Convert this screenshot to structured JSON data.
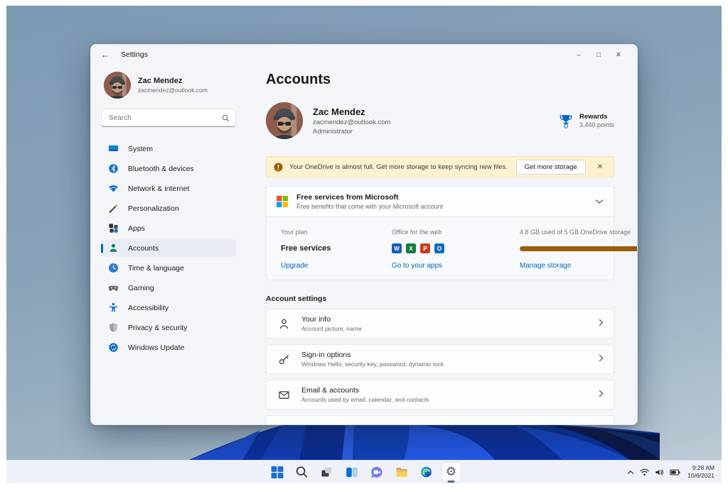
{
  "window": {
    "title": "Settings",
    "controls": {
      "minimize": "–",
      "maximize": "□",
      "close": "✕"
    }
  },
  "sidebar": {
    "profile": {
      "name": "Zac Mendez",
      "email": "zacmendez@outlook.com"
    },
    "search": {
      "placeholder": "Search"
    },
    "items": [
      {
        "label": "System",
        "icon": "system-icon",
        "selected": false
      },
      {
        "label": "Bluetooth & devices",
        "icon": "bluetooth-icon",
        "selected": false
      },
      {
        "label": "Network & internet",
        "icon": "network-icon",
        "selected": false
      },
      {
        "label": "Personalization",
        "icon": "personalization-icon",
        "selected": false
      },
      {
        "label": "Apps",
        "icon": "apps-icon",
        "selected": false
      },
      {
        "label": "Accounts",
        "icon": "accounts-icon",
        "selected": true
      },
      {
        "label": "Time & language",
        "icon": "time-language-icon",
        "selected": false
      },
      {
        "label": "Gaming",
        "icon": "gaming-icon",
        "selected": false
      },
      {
        "label": "Accessibility",
        "icon": "accessibility-icon",
        "selected": false
      },
      {
        "label": "Privacy & security",
        "icon": "privacy-icon",
        "selected": false
      },
      {
        "label": "Windows Update",
        "icon": "windows-update-icon",
        "selected": false
      }
    ]
  },
  "main": {
    "page_title": "Accounts",
    "profile": {
      "name": "Zac Mendez",
      "email": "zacmendez@outlook.com",
      "role": "Administrator"
    },
    "rewards": {
      "label": "Rewards",
      "points": "3,440 points",
      "icon": "rewards-trophy-icon",
      "color": "#0b64c8"
    },
    "banner": {
      "message": "Your OneDrive is almost full. Get more storage to keep syncing new files.",
      "button": "Get more storage",
      "icon": "warning-icon",
      "background": "#fdf1cf",
      "icon_color": "#9d5c00"
    },
    "free_services": {
      "title": "Free services from Microsoft",
      "subtitle": "Free benefits that come with your Microsoft account",
      "icon": "microsoft-logo"
    },
    "plan": {
      "your_plan": {
        "label": "Your plan",
        "value": "Free services",
        "link": "Upgrade"
      },
      "office": {
        "label": "Office for the web",
        "link": "Go to your apps",
        "apps": [
          {
            "name": "word",
            "letter": "W",
            "color": "#185abd"
          },
          {
            "name": "excel",
            "letter": "X",
            "color": "#107c41"
          },
          {
            "name": "powerpoint",
            "letter": "P",
            "color": "#c4401c"
          },
          {
            "name": "outlook",
            "letter": "O",
            "color": "#0f6cbd"
          }
        ]
      },
      "storage": {
        "label": "4.8 GB used of 5 GB OneDrive storage",
        "link": "Manage storage",
        "progress_percent": 78,
        "bar_color": "#9a5c07"
      }
    },
    "account_settings": {
      "header": "Account settings",
      "items": [
        {
          "title": "Your info",
          "subtitle": "Account picture, name",
          "icon": "person-icon"
        },
        {
          "title": "Sign-in options",
          "subtitle": "Windows Hello, security key, password, dynamic lock",
          "icon": "key-icon"
        },
        {
          "title": "Email & accounts",
          "subtitle": "Accounts used by email, calendar, and contacts",
          "icon": "envelope-icon"
        }
      ]
    },
    "accent_color": "#0067c0"
  },
  "taskbar": {
    "icons": [
      {
        "name": "start"
      },
      {
        "name": "search"
      },
      {
        "name": "task-view"
      },
      {
        "name": "widgets"
      },
      {
        "name": "chat"
      },
      {
        "name": "file-explorer"
      },
      {
        "name": "edge"
      },
      {
        "name": "settings",
        "active": true
      }
    ],
    "settings_glyph": "⚙",
    "tray": {
      "time": "9:28 AM",
      "date": "10/6/2021"
    }
  }
}
